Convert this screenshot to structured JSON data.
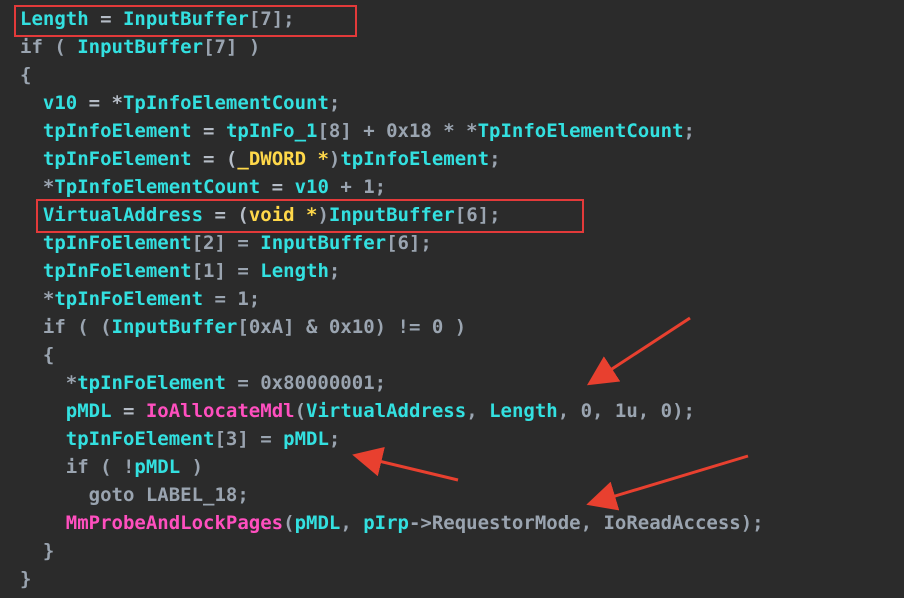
{
  "colors": {
    "background": "#2b2b2b",
    "identifier": "#33e0e0",
    "keyword_plain": "#9aa4b0",
    "type": "#ffd84a",
    "function": "#ff4fbf",
    "highlight_box": "#e33a3a",
    "arrow": "#e8402f"
  },
  "lines": [
    [
      {
        "t": "Length",
        "c": "var"
      },
      {
        "t": " = ",
        "c": "op"
      },
      {
        "t": "InputBuffer",
        "c": "var"
      },
      {
        "t": "[7];",
        "c": "plain"
      }
    ],
    [
      {
        "t": "if",
        "c": "kw"
      },
      {
        "t": " ( ",
        "c": "plain"
      },
      {
        "t": "InputBuffer",
        "c": "var"
      },
      {
        "t": "[7] )",
        "c": "plain"
      }
    ],
    [
      {
        "t": "{",
        "c": "plain"
      }
    ],
    [
      {
        "t": "  ",
        "c": "plain"
      },
      {
        "t": "v10",
        "c": "var"
      },
      {
        "t": " = *",
        "c": "op"
      },
      {
        "t": "TpInfoElementCount",
        "c": "var"
      },
      {
        "t": ";",
        "c": "plain"
      }
    ],
    [
      {
        "t": "  ",
        "c": "plain"
      },
      {
        "t": "tpInfoElement",
        "c": "var"
      },
      {
        "t": " = ",
        "c": "op"
      },
      {
        "t": "tpInFo_1",
        "c": "var"
      },
      {
        "t": "[8] + 0x18 * *",
        "c": "plain"
      },
      {
        "t": "TpInfoElementCount",
        "c": "var"
      },
      {
        "t": ";",
        "c": "plain"
      }
    ],
    [
      {
        "t": "  ",
        "c": "plain"
      },
      {
        "t": "tpInFoElement",
        "c": "var"
      },
      {
        "t": " = (",
        "c": "op"
      },
      {
        "t": "_DWORD *",
        "c": "type"
      },
      {
        "t": ")",
        "c": "plain"
      },
      {
        "t": "tpInfoElement",
        "c": "var"
      },
      {
        "t": ";",
        "c": "plain"
      }
    ],
    [
      {
        "t": "  *",
        "c": "plain"
      },
      {
        "t": "TpInfoElementCount",
        "c": "var"
      },
      {
        "t": " = ",
        "c": "op"
      },
      {
        "t": "v10",
        "c": "var"
      },
      {
        "t": " + 1;",
        "c": "plain"
      }
    ],
    [
      {
        "t": "  ",
        "c": "plain"
      },
      {
        "t": "VirtualAddress",
        "c": "var"
      },
      {
        "t": " = (",
        "c": "op"
      },
      {
        "t": "void *",
        "c": "type"
      },
      {
        "t": ")",
        "c": "plain"
      },
      {
        "t": "InputBuffer",
        "c": "var"
      },
      {
        "t": "[6];",
        "c": "plain"
      }
    ],
    [
      {
        "t": "  ",
        "c": "plain"
      },
      {
        "t": "tpInFoElement",
        "c": "var"
      },
      {
        "t": "[2] = ",
        "c": "plain"
      },
      {
        "t": "InputBuffer",
        "c": "var"
      },
      {
        "t": "[6];",
        "c": "plain"
      }
    ],
    [
      {
        "t": "  ",
        "c": "plain"
      },
      {
        "t": "tpInFoElement",
        "c": "var"
      },
      {
        "t": "[1] = ",
        "c": "plain"
      },
      {
        "t": "Length",
        "c": "var"
      },
      {
        "t": ";",
        "c": "plain"
      }
    ],
    [
      {
        "t": "  *",
        "c": "plain"
      },
      {
        "t": "tpInFoElement",
        "c": "var"
      },
      {
        "t": " = 1;",
        "c": "plain"
      }
    ],
    [
      {
        "t": "  if",
        "c": "kw"
      },
      {
        "t": " ( (",
        "c": "plain"
      },
      {
        "t": "InputBuffer",
        "c": "var"
      },
      {
        "t": "[0xA] & 0x10) != 0 )",
        "c": "plain"
      }
    ],
    [
      {
        "t": "  {",
        "c": "plain"
      }
    ],
    [
      {
        "t": "    *",
        "c": "plain"
      },
      {
        "t": "tpInFoElement",
        "c": "var"
      },
      {
        "t": " = 0x80000001;",
        "c": "plain"
      }
    ],
    [
      {
        "t": "    ",
        "c": "plain"
      },
      {
        "t": "pMDL",
        "c": "var"
      },
      {
        "t": " = ",
        "c": "op"
      },
      {
        "t": "IoAllocateMdl",
        "c": "fn"
      },
      {
        "t": "(",
        "c": "plain"
      },
      {
        "t": "VirtualAddress",
        "c": "var"
      },
      {
        "t": ", ",
        "c": "plain"
      },
      {
        "t": "Length",
        "c": "var"
      },
      {
        "t": ", 0, 1u, 0);",
        "c": "plain"
      }
    ],
    [
      {
        "t": "    ",
        "c": "plain"
      },
      {
        "t": "tpInFoElement",
        "c": "var"
      },
      {
        "t": "[3] = ",
        "c": "plain"
      },
      {
        "t": "pMDL",
        "c": "var"
      },
      {
        "t": ";",
        "c": "plain"
      }
    ],
    [
      {
        "t": "    if",
        "c": "kw"
      },
      {
        "t": " ( !",
        "c": "plain"
      },
      {
        "t": "pMDL",
        "c": "var"
      },
      {
        "t": " )",
        "c": "plain"
      }
    ],
    [
      {
        "t": "      goto LABEL_18;",
        "c": "plain"
      }
    ],
    [
      {
        "t": "    ",
        "c": "plain"
      },
      {
        "t": "MmProbeAndLockPages",
        "c": "fn"
      },
      {
        "t": "(",
        "c": "plain"
      },
      {
        "t": "pMDL",
        "c": "var"
      },
      {
        "t": ", ",
        "c": "plain"
      },
      {
        "t": "pIrp",
        "c": "var"
      },
      {
        "t": "->RequestorMode, IoReadAccess);",
        "c": "plain"
      }
    ],
    [
      {
        "t": "  }",
        "c": "plain"
      }
    ],
    [
      {
        "t": "}",
        "c": "plain"
      }
    ]
  ]
}
